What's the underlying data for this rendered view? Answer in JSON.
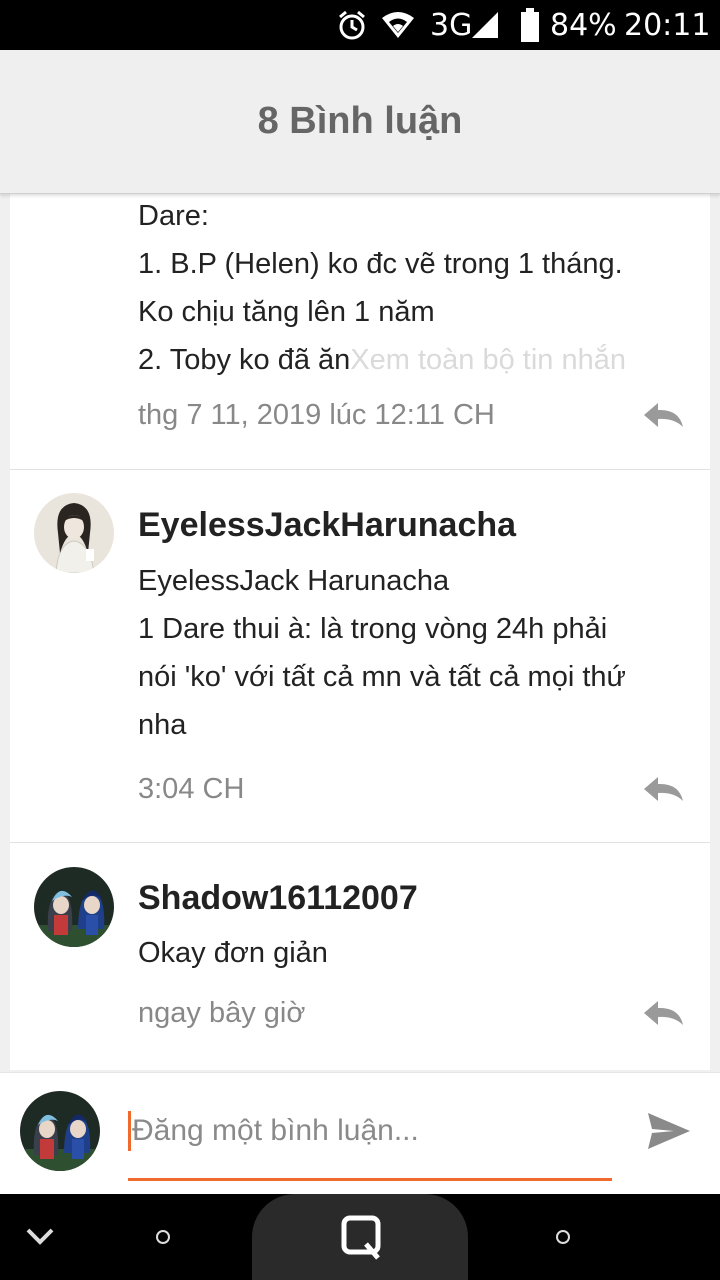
{
  "status_bar": {
    "network": "3G",
    "battery": "84%",
    "time": "20:11",
    "icons": [
      "alarm-icon",
      "wifi-icon",
      "signal-icon",
      "battery-icon"
    ]
  },
  "header": {
    "title": "8 Bình luận"
  },
  "comments": [
    {
      "author": "",
      "lines": [
        "Dare:",
        "1. B.P (Helen) ko đc vẽ trong 1 tháng.",
        "Ko chịu tăng lên 1 năm",
        "2. Toby ko đã ăn"
      ],
      "more_link": "Xem toàn bộ tin nhắn",
      "time": "thg 7 11, 2019 lúc 12:11 CH"
    },
    {
      "author": "EyelessJackHarunacha",
      "lines": [
        "EyelessJack Harunacha",
        "1 Dare thui à: là trong vòng 24h phải",
        "nói 'ko' với tất cả mn và tất cả mọi thứ",
        "nha"
      ],
      "time": "3:04 CH"
    },
    {
      "author": "Shadow16112007",
      "lines": [
        "Okay đơn giản"
      ],
      "time": "ngay bây giờ"
    }
  ],
  "input": {
    "placeholder": "Đăng một bình luận..."
  },
  "colors": {
    "accent": "#f06a2c",
    "header_bg": "#efefef",
    "meta_text": "#888888"
  }
}
